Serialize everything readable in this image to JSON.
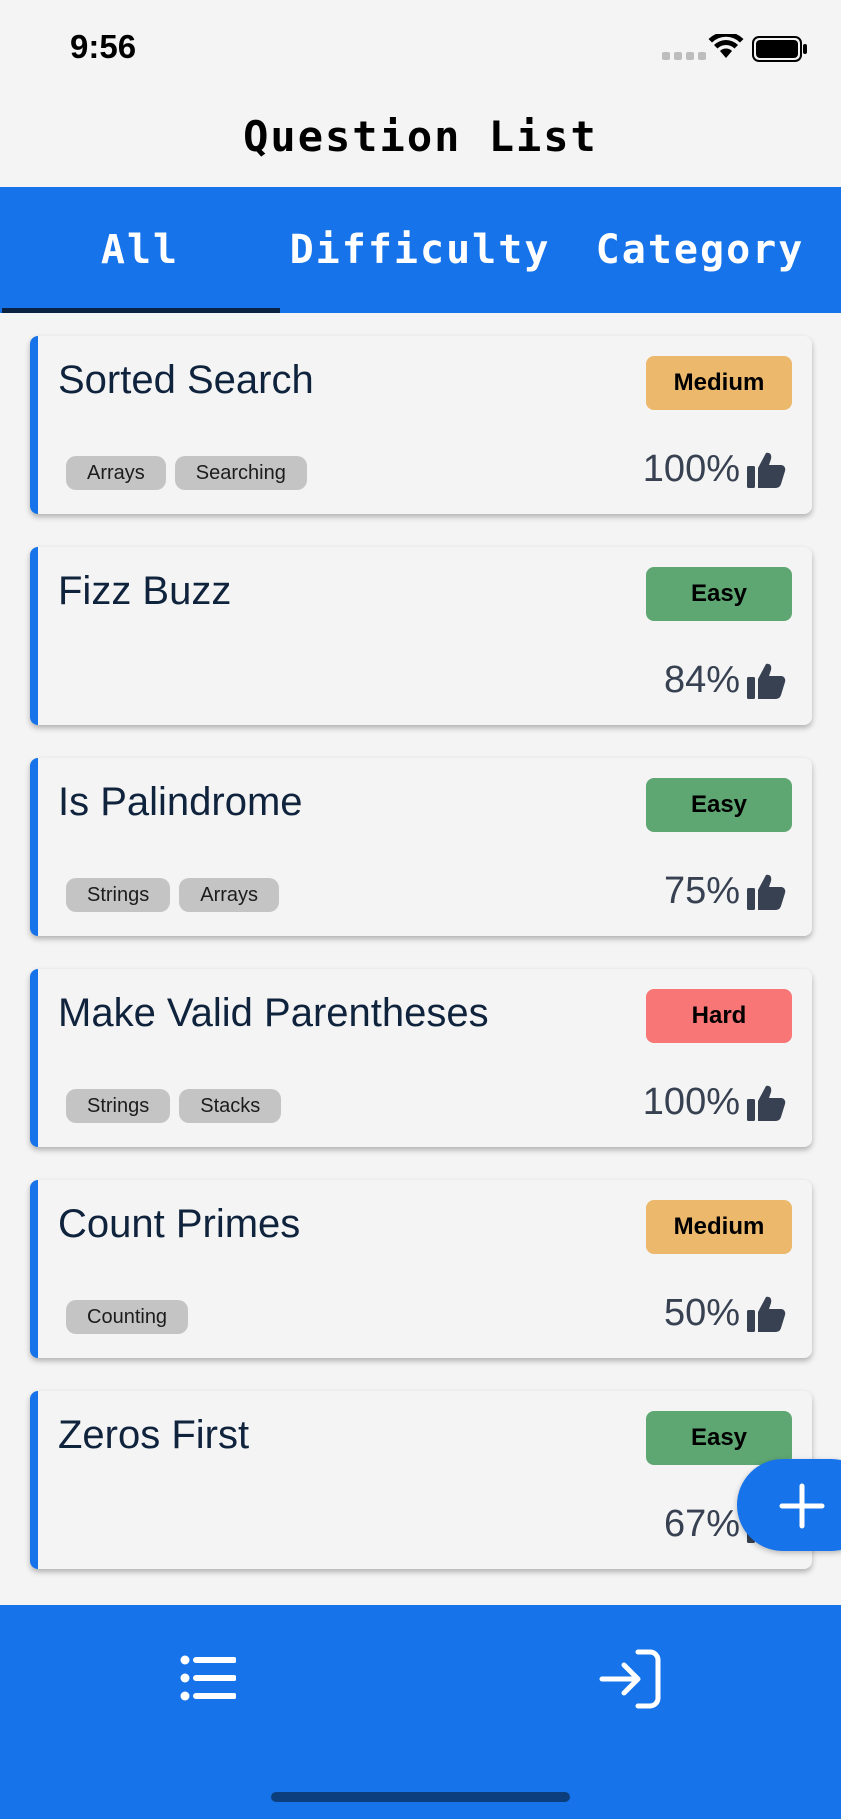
{
  "status_bar": {
    "time": "9:56"
  },
  "header": {
    "title": "Question List"
  },
  "tabs": [
    {
      "label": "All",
      "active": true
    },
    {
      "label": "Difficulty",
      "active": false
    },
    {
      "label": "Category",
      "active": false
    }
  ],
  "questions": [
    {
      "title": "Sorted Search",
      "difficulty": "Medium",
      "difficulty_color": "#ecb86c",
      "tags": [
        "Arrays",
        "Searching"
      ],
      "rating": "100%"
    },
    {
      "title": "Fizz Buzz",
      "difficulty": "Easy",
      "difficulty_color": "#5ea672",
      "tags": [],
      "rating": "84%"
    },
    {
      "title": "Is Palindrome",
      "difficulty": "Easy",
      "difficulty_color": "#5ea672",
      "tags": [
        "Strings",
        "Arrays"
      ],
      "rating": "75%"
    },
    {
      "title": "Make Valid Parentheses",
      "difficulty": "Hard",
      "difficulty_color": "#f87676",
      "tags": [
        "Strings",
        "Stacks"
      ],
      "rating": "100%"
    },
    {
      "title": "Count Primes",
      "difficulty": "Medium",
      "difficulty_color": "#ecb86c",
      "tags": [
        "Counting"
      ],
      "rating": "50%"
    },
    {
      "title": "Zeros First",
      "difficulty": "Easy",
      "difficulty_color": "#5ea672",
      "tags": [],
      "rating": "67%"
    }
  ],
  "icons": {
    "rating": "thumbs-up-icon",
    "fab": "plus-icon",
    "nav_list": "list-icon",
    "nav_login": "login-icon"
  },
  "colors": {
    "accent": "#1673ea",
    "tab_indicator": "#0c2244"
  }
}
